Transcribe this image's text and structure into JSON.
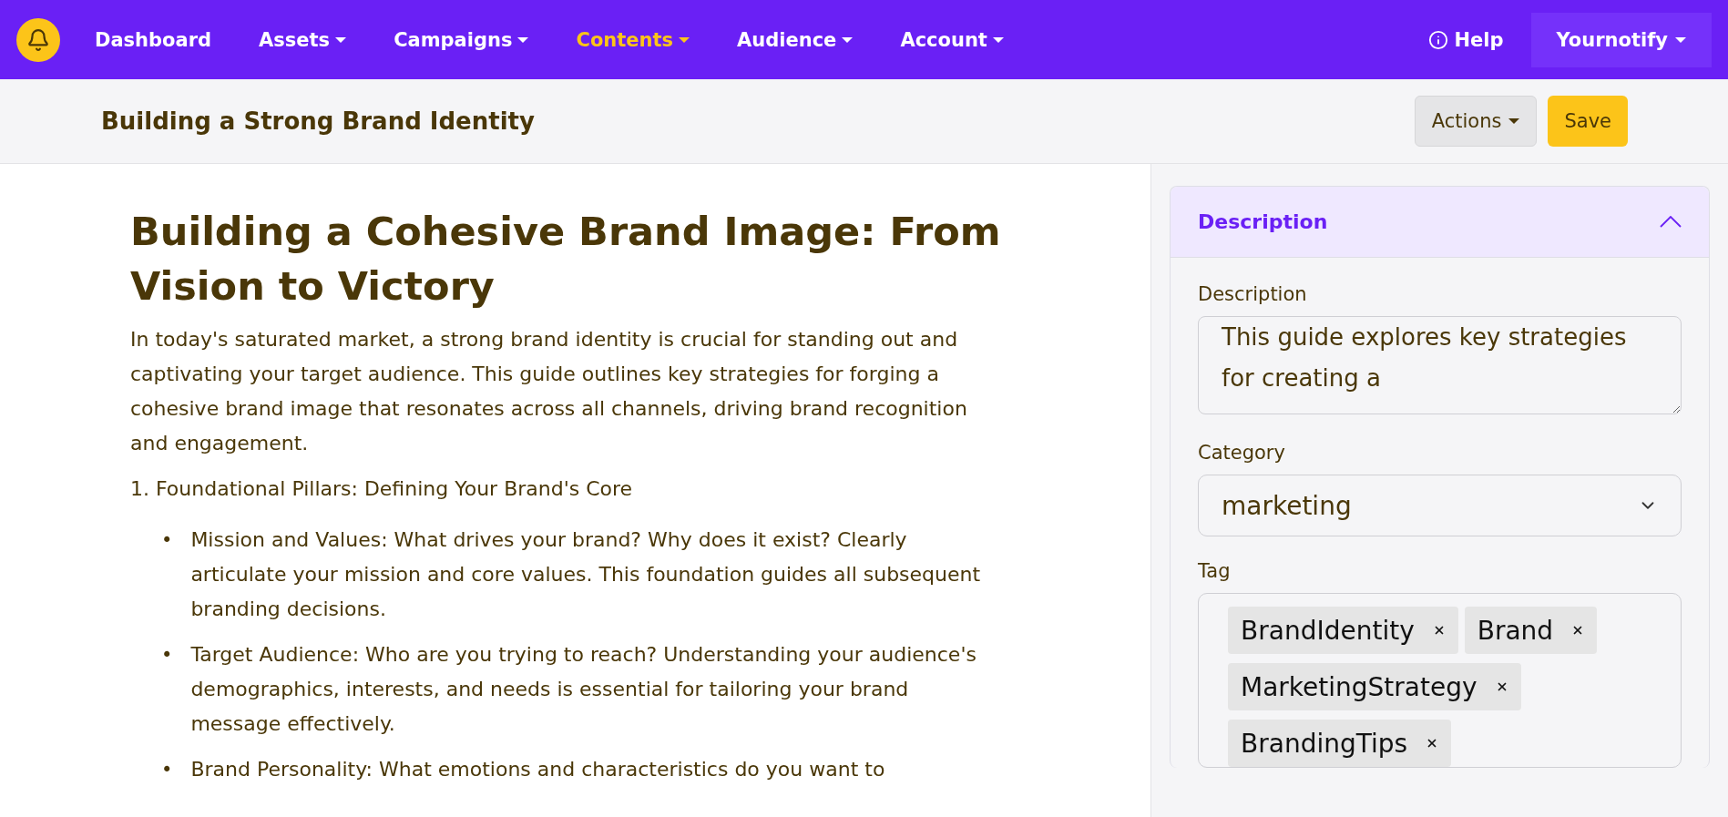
{
  "navbar": {
    "items": [
      {
        "label": "Dashboard",
        "dropdown": false,
        "selected": false
      },
      {
        "label": "Assets",
        "dropdown": true,
        "selected": false
      },
      {
        "label": "Campaigns",
        "dropdown": true,
        "selected": false
      },
      {
        "label": "Contents",
        "dropdown": true,
        "selected": true
      },
      {
        "label": "Audience",
        "dropdown": true,
        "selected": false
      },
      {
        "label": "Account",
        "dropdown": true,
        "selected": false
      }
    ],
    "help": "Help",
    "account": "Yournotify"
  },
  "header": {
    "title": "Building a Strong Brand Identity",
    "actions": "Actions",
    "save": "Save"
  },
  "article": {
    "title": "Building a Cohesive Brand Image: From Vision to Victory",
    "intro": "In today's saturated market, a strong brand identity is crucial for standing out and captivating your target audience. This guide outlines key strategies for forging a cohesive brand image that resonates across all channels, driving brand recognition and engagement.",
    "section": "1. Foundational Pillars: Defining Your Brand's Core",
    "bullet_mark": "•",
    "bullets": [
      "Mission and Values: What drives your brand? Why does it exist? Clearly articulate your mission and core values. This foundation guides all subsequent branding decisions.",
      "Target Audience: Who are you trying to reach? Understanding your audience's demographics, interests, and needs is essential for tailoring your brand message effectively.",
      "Brand Personality: What emotions and characteristics do you want to"
    ]
  },
  "panel": {
    "title": "Description",
    "expanded": true,
    "description_label": "Description",
    "description": "This guide explores key strategies for creating a",
    "category_label": "Category",
    "category": "marketing",
    "tag_label": "Tag",
    "tags": [
      "BrandIdentity",
      "Brand",
      "MarketingStrategy",
      "BrandingTips"
    ]
  }
}
